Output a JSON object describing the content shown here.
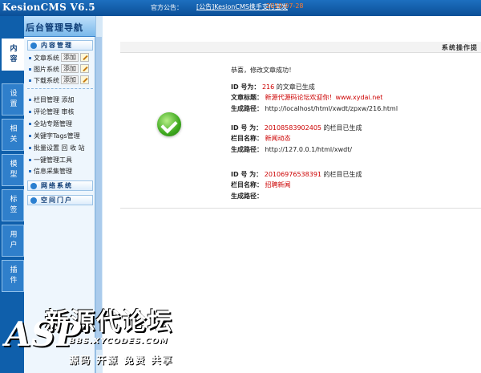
{
  "header": {
    "logo": "KesionCMS V6.5",
    "notice_label": "官方公告：",
    "notice_link": "[公告]KesionCMS携手支付宝发",
    "notice_date": "2010-07-28"
  },
  "nav": {
    "title": "后台管理导航",
    "vtabs": [
      "内容",
      "设置",
      "相关",
      "模型",
      "标签",
      "用户",
      "插件"
    ],
    "sections": {
      "content_manage": "内容管理",
      "network_system": "网络系统",
      "space_portal": "空间门户"
    },
    "systems": [
      {
        "label": "文章系统",
        "add": "添加"
      },
      {
        "label": "图片系统",
        "add": "添加"
      },
      {
        "label": "下载系统",
        "add": "添加"
      }
    ],
    "items": [
      "栏目管理 添加",
      "评论管理 审核",
      "全站专题管理",
      "关键字Tags管理",
      "批量设置 回 收 站",
      "一键管理工具",
      "信息采集管理"
    ]
  },
  "main": {
    "title": "系统操作提",
    "success_msg": "恭喜，修改文章成功！",
    "block1": {
      "id_label": "ID 号为：",
      "id_value": "216",
      "id_suffix": "的文章已生成",
      "title_label": "文章标题：",
      "title_value": "新源代源码论坛欢迎你！www.xydai.net",
      "path_label": "生成路径：",
      "path_value": "http://localhost/html/xwdt/zpxw/216.html"
    },
    "block2": {
      "id_label": "ID 号 为：",
      "id_value": "20108583902405",
      "id_suffix": "的栏目已生成",
      "name_label": "栏目名称：",
      "name_value": "新闻动态",
      "path_label": "生成路径：",
      "path_value": "http://127.0.0.1/html/xwdt/"
    },
    "block3": {
      "id_label": "ID 号 为：",
      "id_value": "20106976538391",
      "id_suffix": "的栏目已生成",
      "name_label": "栏目名称：",
      "name_value": "招聘新闻",
      "path_label": "生成路径："
    }
  },
  "watermark": {
    "title": "新源代论坛",
    "asp": "ASP",
    "url": "BBS.XYCODES.COM",
    "slogan": "源码 开源 免费 共享"
  }
}
